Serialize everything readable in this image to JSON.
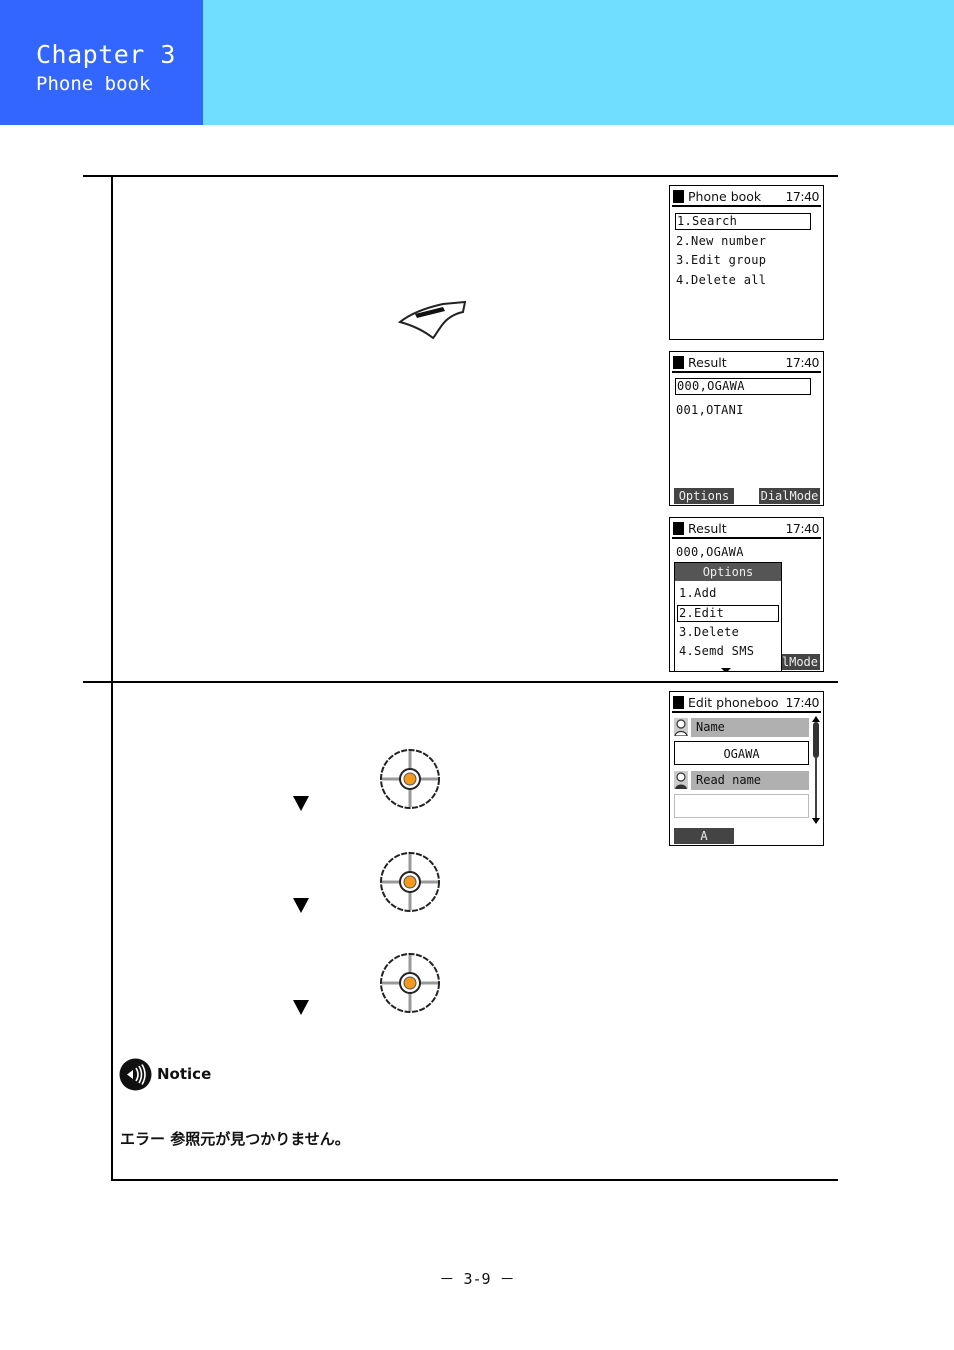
{
  "header": {
    "chapter": "Chapter 3",
    "subtitle": "Phone book",
    "colors": {
      "left": "#3366ff",
      "right": "#6fdfff"
    }
  },
  "screens": [
    {
      "title": "Phone book",
      "time": "17:40",
      "items": [
        "1.Search",
        "2.New number",
        "3.Edit group",
        "4.Delete all"
      ],
      "selected_index": 0
    },
    {
      "title": "Result",
      "time": "17:40",
      "items": [
        "000,OGAWA",
        "001,OTANI"
      ],
      "selected_index": 0,
      "softkeys": {
        "left": "Options",
        "right": "DialMode"
      }
    },
    {
      "title": "Result",
      "time": "17:40",
      "items": [
        "000,OGAWA"
      ],
      "softkeys": {
        "right": "lMode"
      },
      "popup": {
        "title": "Options",
        "items": [
          "1.Add",
          "2.Edit",
          "3.Delete",
          "4.Semd SMS"
        ],
        "selected_index": 1
      }
    },
    {
      "title": "Edit phoneboo",
      "time": "17:40",
      "fields": [
        {
          "label": "Name",
          "value": "OGAWA"
        },
        {
          "label": "Read name",
          "value": ""
        }
      ],
      "input_mode": "A"
    }
  ],
  "steps": {
    "icons": [
      "flip-key-icon",
      "joystick-icon",
      "joystick-icon",
      "joystick-icon"
    ]
  },
  "notice": {
    "label": "Notice",
    "text": "エラー 参照元が見つかりません。"
  },
  "footer": {
    "page_number": "－ 3-9 －"
  }
}
